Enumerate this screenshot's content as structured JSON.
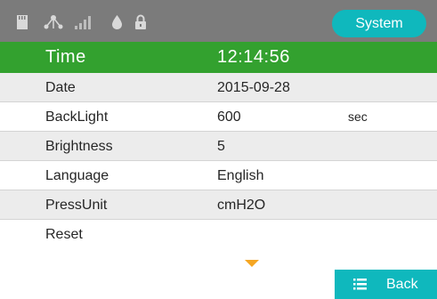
{
  "header": {
    "tab_label": "System",
    "icons": [
      "sd-card-icon",
      "network-icon",
      "signal-icon",
      "water-drop-icon",
      "lock-icon"
    ]
  },
  "settings": [
    {
      "label": "Time",
      "value": "12:14:56",
      "unit": "",
      "selected": true
    },
    {
      "label": "Date",
      "value": "2015-09-28",
      "unit": ""
    },
    {
      "label": "BackLight",
      "value": "600",
      "unit": "sec"
    },
    {
      "label": "Brightness",
      "value": "5",
      "unit": ""
    },
    {
      "label": "Language",
      "value": "English",
      "unit": ""
    },
    {
      "label": "PressUnit",
      "value": "cmH2O",
      "unit": ""
    },
    {
      "label": "Reset",
      "value": "",
      "unit": ""
    }
  ],
  "footer": {
    "back_label": "Back"
  },
  "colors": {
    "status_bar": "#7b7b7b",
    "accent_teal": "#0fb8bd",
    "selected_green": "#33a12f",
    "row_alt": "#ececec",
    "scroll_arrow": "#f5a623"
  }
}
